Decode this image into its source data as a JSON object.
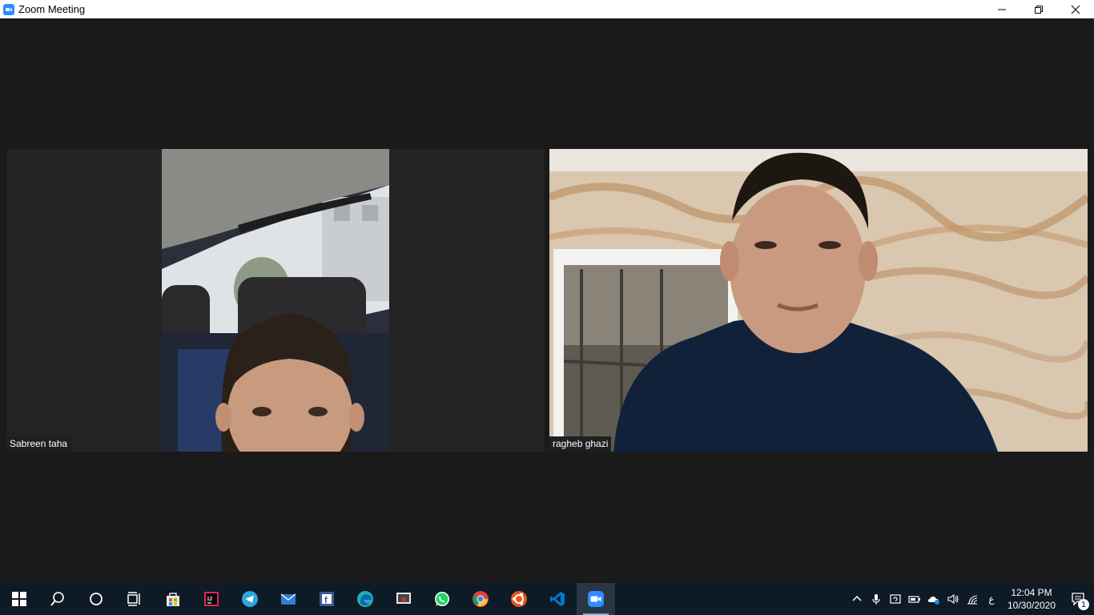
{
  "window": {
    "title": "Zoom Meeting",
    "controls": [
      "minimize-icon",
      "restore-icon",
      "close-icon"
    ]
  },
  "participants": [
    {
      "name": "Sabreen taha"
    },
    {
      "name": "ragheb ghazi"
    }
  ],
  "taskbar": {
    "apps": [
      "start",
      "search",
      "cortana",
      "task-view",
      "store",
      "intellij",
      "telegram",
      "mail",
      "facebook",
      "edge",
      "snip",
      "whatsapp",
      "chrome",
      "ubuntu",
      "vscode",
      "zoom"
    ],
    "active_app": "zoom",
    "tray": {
      "input_language": "ع",
      "time": "12:04 PM",
      "date": "10/30/2020",
      "notification_count": "1"
    }
  },
  "colors": {
    "meeting_bg": "#1a1a1a",
    "tile_bg": "#232323",
    "taskbar_bg": "#0e1a26",
    "zoom_blue": "#2d8cff"
  }
}
